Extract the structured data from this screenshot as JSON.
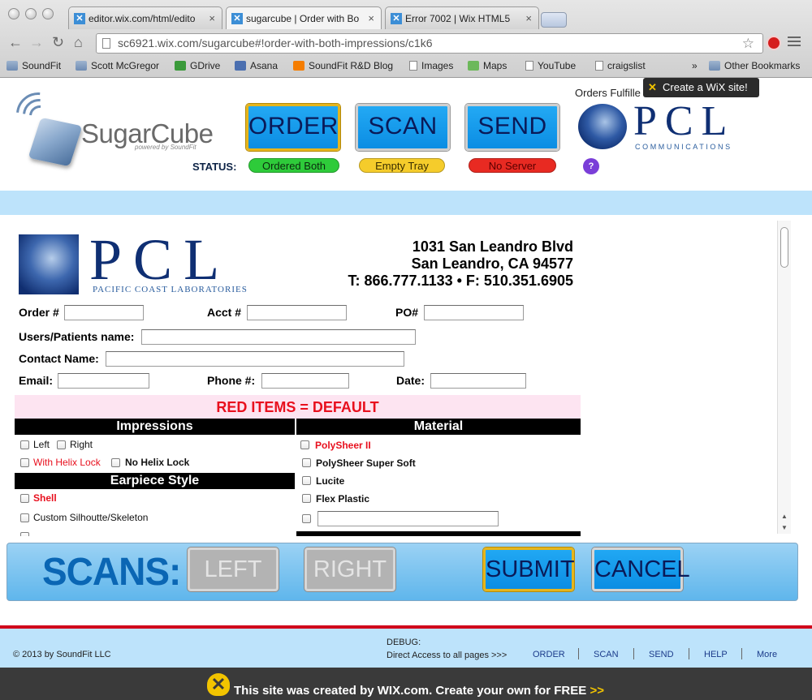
{
  "browser": {
    "tabs": [
      {
        "label": "editor.wix.com/html/edito",
        "active": false
      },
      {
        "label": "sugarcube | Order with Bo",
        "active": true
      },
      {
        "label": "Error 7002 | Wix HTML5",
        "active": false
      }
    ],
    "url": "sc6921.wix.com/sugarcube#!order-with-both-impressions/c1k6",
    "bookmarks": [
      "SoundFit",
      "Scott McGregor",
      "GDrive",
      "Asana",
      "SoundFit R&D Blog",
      "Images",
      "Maps",
      "YouTube",
      "craigslist"
    ],
    "more_bookmarks": "»",
    "other_bookmarks": "Other Bookmarks"
  },
  "header": {
    "brand_name": "SugarCube",
    "brand_sub": "powered by SoundFit",
    "nav": {
      "order": "ORDER",
      "scan": "SCAN",
      "send": "SEND"
    },
    "status_label": "STATUS:",
    "status": [
      {
        "text": "Ordered Both",
        "color": "#2ecb3a"
      },
      {
        "text": "Empty Tray",
        "color": "#f5cc2b"
      },
      {
        "text": "No Server",
        "color": "#e82a22"
      }
    ],
    "help_icon": "?",
    "orders_fulfilled": "Orders Fulfille",
    "wix_tip": "Create a WiX site!",
    "partner_name": "PCL",
    "partner_sub": "COMMUNICATIONS"
  },
  "form": {
    "lab_logo": "PCL",
    "lab_name": "PACIFIC COAST LABORATORIES",
    "address1": "1031 San Leandro Blvd",
    "address2": "San Leandro, CA 94577",
    "phone": "T: 866.777.1133 • F: 510.351.6905",
    "fields": {
      "order": "Order #",
      "acct": "Acct #",
      "po": "PO#",
      "patients": "Users/Patients name:",
      "contact": "Contact Name:",
      "email": "Email:",
      "phone": "Phone #:",
      "date": "Date:"
    },
    "default_banner": "RED ITEMS = DEFAULT",
    "impressions_header": "Impressions",
    "material_header": "Material",
    "earpiece_header": "Earpiece Style",
    "impressions": {
      "left": "Left",
      "right": "Right",
      "helix": "With Helix Lock",
      "nohelix": "No Helix Lock"
    },
    "earpiece": {
      "shell": "Shell",
      "custom": "Custom Silhoutte/Skeleton"
    },
    "material": {
      "poly2": "PolySheer II",
      "polysoft": "PolySheer Super Soft",
      "lucite": "Lucite",
      "flex": "Flex Plastic"
    }
  },
  "scans": {
    "label": "SCANS:",
    "left": "LEFT",
    "right": "RIGHT",
    "submit": "SUBMIT",
    "cancel": "CANCEL"
  },
  "footer": {
    "copyright": "© 2013 by SoundFit LLC",
    "debug": "DEBUG:",
    "direct": "Direct Access to all pages  >>>",
    "links": [
      "ORDER",
      "SCAN",
      "SEND",
      "HELP",
      "More"
    ]
  },
  "wix_banner": {
    "text": "This site was created by WIX.com. Create your own for FREE",
    "arrows": ">>"
  },
  "icons": {
    "back": "back-arrow-icon",
    "forward": "forward-arrow-icon",
    "reload": "reload-icon",
    "home": "home-icon",
    "star": "bookmark-star-icon",
    "wrench": "wrench-menu-icon"
  }
}
